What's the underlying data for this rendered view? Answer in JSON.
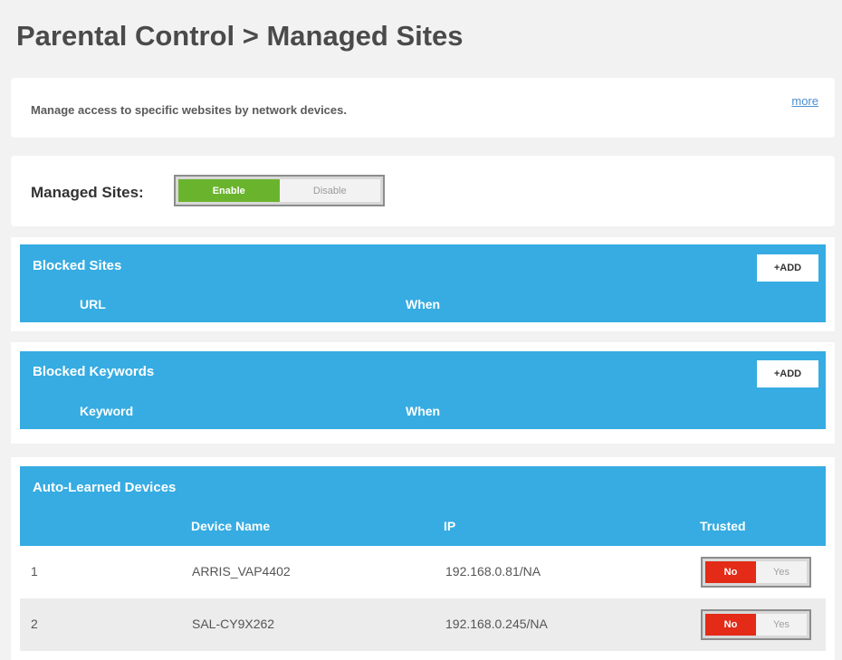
{
  "page": {
    "title": "Parental Control > Managed Sites"
  },
  "description": {
    "text": "Manage access to specific websites by network devices.",
    "more_link": "more"
  },
  "managed_sites": {
    "label": "Managed Sites:",
    "enable_label": "Enable",
    "disable_label": "Disable",
    "selected": "Enable"
  },
  "blocked_sites": {
    "title": "Blocked Sites",
    "add_label": "+ADD",
    "columns": [
      "URL",
      "When"
    ]
  },
  "blocked_keywords": {
    "title": "Blocked Keywords",
    "add_label": "+ADD",
    "columns": [
      "Keyword",
      "When"
    ]
  },
  "auto_learned": {
    "title": "Auto-Learned Devices",
    "columns": [
      "Device Name",
      "IP",
      "Trusted"
    ],
    "rows": [
      {
        "index": "1",
        "name": "ARRIS_VAP4402",
        "ip": "192.168.0.81/NA",
        "no_label": "No",
        "yes_label": "Yes",
        "trusted": "No"
      },
      {
        "index": "2",
        "name": "SAL-CY9X262",
        "ip": "192.168.0.245/NA",
        "no_label": "No",
        "yes_label": "Yes",
        "trusted": "No"
      }
    ]
  },
  "colors": {
    "section_blue": "#36ace2",
    "enable_green": "#6ab42d",
    "no_red": "#e32b17",
    "link_blue": "#4a8fd0"
  }
}
